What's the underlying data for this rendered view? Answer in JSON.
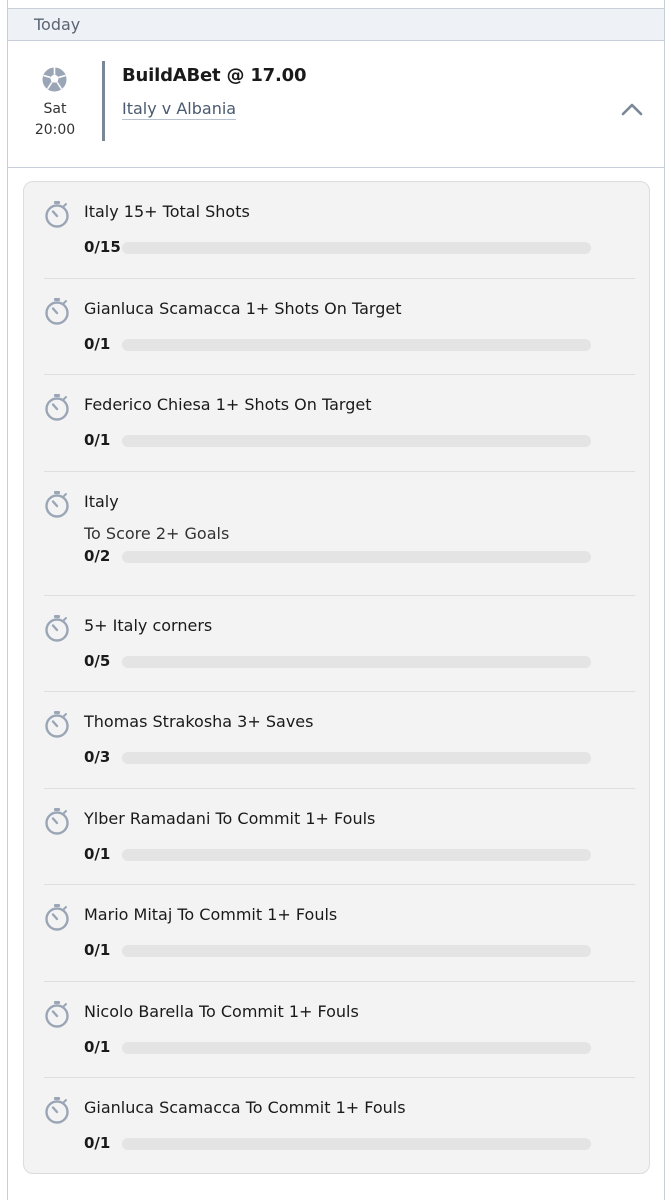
{
  "day_header": {
    "label": "Today"
  },
  "event": {
    "day": "Sat",
    "time": "20:00",
    "title": "BuildABet @ 17.00",
    "match": "Italy v Albania",
    "sport_icon": "football-icon",
    "toggle_icon": "chevron-up-icon"
  },
  "colors": {
    "icon_stroke": "#9aa6b6",
    "divider": "#7a8797",
    "bar_track": "#e4e4e4",
    "panel_bg": "#f3f3f3"
  },
  "legs": [
    {
      "title": "Italy 15+ Total Shots",
      "subtitle": "",
      "count_label": "0/15",
      "progress": 0,
      "icon": "stopwatch-icon"
    },
    {
      "title": "Gianluca Scamacca 1+ Shots On Target",
      "subtitle": "",
      "count_label": "0/1",
      "progress": 0,
      "icon": "stopwatch-icon"
    },
    {
      "title": "Federico Chiesa 1+ Shots On Target",
      "subtitle": "",
      "count_label": "0/1",
      "progress": 0,
      "icon": "stopwatch-icon"
    },
    {
      "title": "Italy",
      "subtitle": "To Score 2+ Goals",
      "count_label": "0/2",
      "progress": 0,
      "icon": "stopwatch-icon"
    },
    {
      "title": "5+ Italy corners",
      "subtitle": "",
      "count_label": "0/5",
      "progress": 0,
      "icon": "stopwatch-icon"
    },
    {
      "title": "Thomas Strakosha 3+ Saves",
      "subtitle": "",
      "count_label": "0/3",
      "progress": 0,
      "icon": "stopwatch-icon"
    },
    {
      "title": "Ylber Ramadani To Commit 1+ Fouls",
      "subtitle": "",
      "count_label": "0/1",
      "progress": 0,
      "icon": "stopwatch-icon"
    },
    {
      "title": "Mario Mitaj To Commit 1+ Fouls",
      "subtitle": "",
      "count_label": "0/1",
      "progress": 0,
      "icon": "stopwatch-icon"
    },
    {
      "title": "Nicolo Barella To Commit 1+ Fouls",
      "subtitle": "",
      "count_label": "0/1",
      "progress": 0,
      "icon": "stopwatch-icon"
    },
    {
      "title": "Gianluca Scamacca To Commit 1+ Fouls",
      "subtitle": "",
      "count_label": "0/1",
      "progress": 0,
      "icon": "stopwatch-icon"
    }
  ]
}
